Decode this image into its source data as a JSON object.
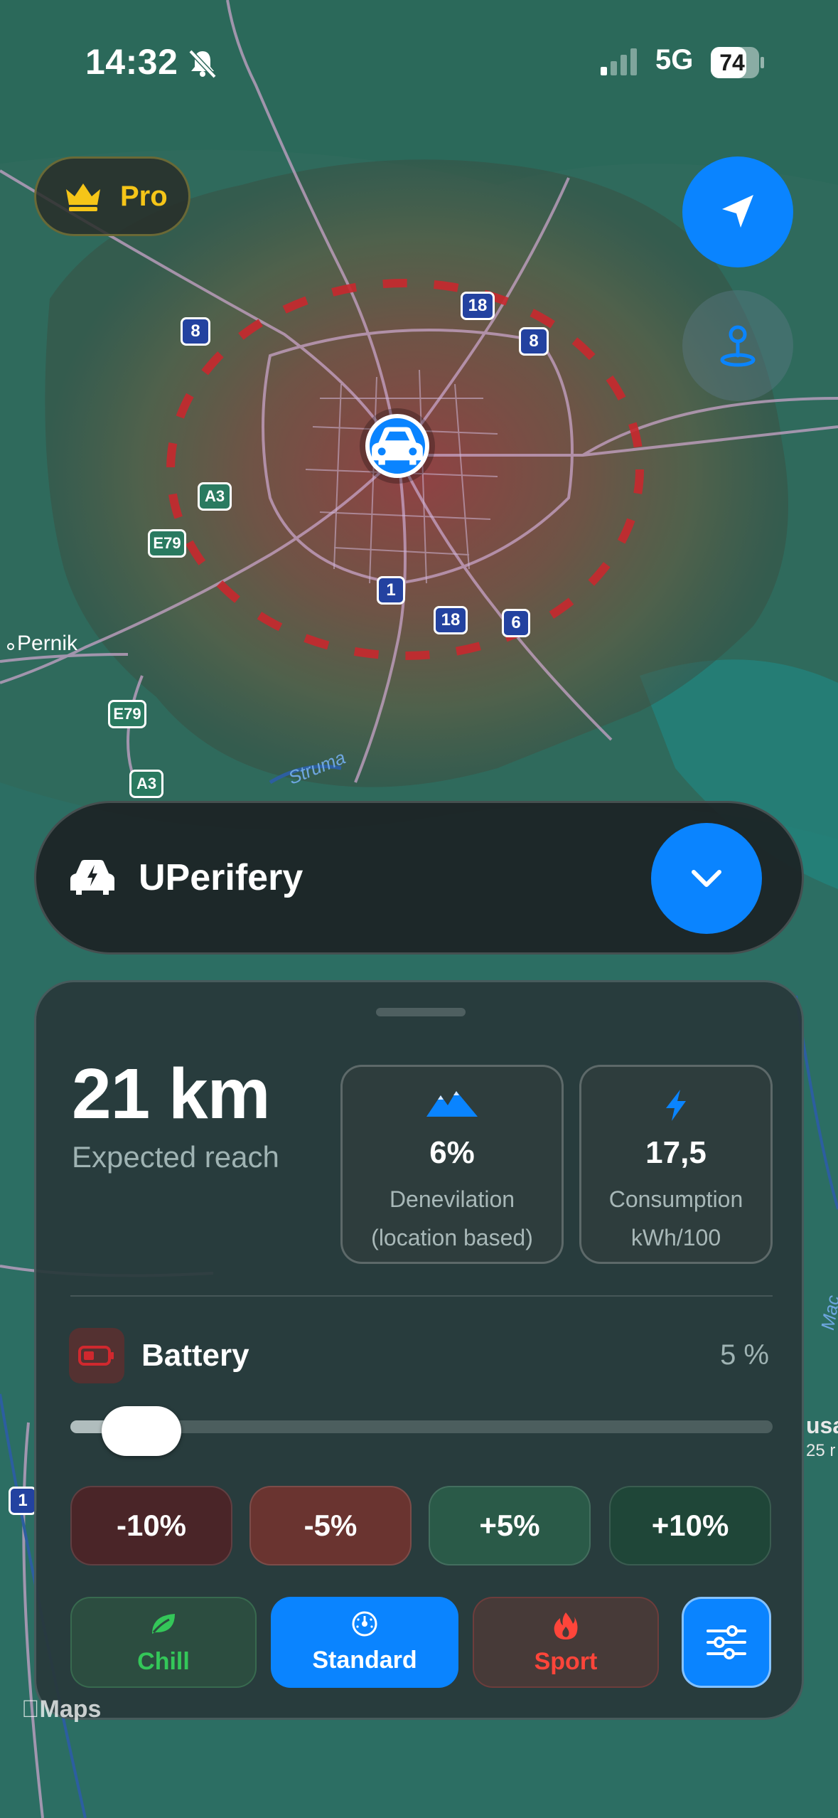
{
  "status_bar": {
    "time": "14:32",
    "network": "5G",
    "battery": "74"
  },
  "map": {
    "place_labels": [
      "Pernik",
      "Struma",
      "Mac"
    ],
    "road_badges": [
      "8",
      "18",
      "8",
      "A3",
      "E79",
      "1",
      "18",
      "6",
      "E79",
      "A3",
      "1"
    ],
    "edge_labels": [
      "usa",
      "25 r"
    ]
  },
  "pro_badge": {
    "label": "Pro"
  },
  "vehicle": {
    "name": "UPerifery"
  },
  "reach": {
    "value": "21 km",
    "label": "Expected reach"
  },
  "elevation": {
    "value": "6%",
    "label_line1": "Denevilation",
    "label_line2": "(location based)"
  },
  "consumption": {
    "value": "17,5",
    "label_line1": "Consumption",
    "label_line2": "kWh/100"
  },
  "battery": {
    "label": "Battery",
    "value_text": "5 %",
    "level": 0.05
  },
  "adjust_buttons": {
    "minus10": "-10%",
    "minus5": "-5%",
    "plus5": "+5%",
    "plus10": "+10%"
  },
  "modes": {
    "chill": "Chill",
    "standard": "Standard",
    "sport": "Sport",
    "selected": "Standard"
  },
  "maps_credit": "Maps",
  "colors": {
    "accent": "#0a84ff",
    "pro_gold": "#f5c518",
    "chill_green": "#34c759",
    "sport_red": "#ff453a",
    "range_dash": "#c8282d"
  },
  "icons": [
    "bell-slash-icon",
    "signal-icon",
    "battery-icon",
    "crown-icon",
    "location-arrow-icon",
    "map-pin-icon",
    "car-icon",
    "electric-car-icon",
    "chevron-down-icon",
    "mountain-icon",
    "bolt-icon",
    "battery-low-icon",
    "leaf-icon",
    "gauge-icon",
    "flame-icon",
    "sliders-icon"
  ]
}
